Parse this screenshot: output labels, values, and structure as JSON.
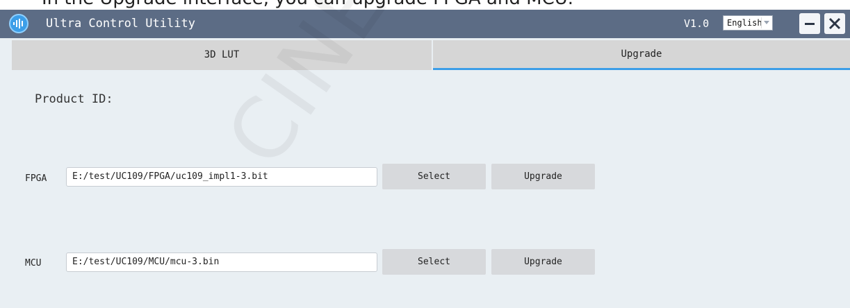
{
  "doc_caption": "In the Upgrade interface, you can upgrade FPGA and MCU.",
  "app": {
    "title": "Ultra Control Utility",
    "version": "V1.0",
    "language": "English",
    "colors": {
      "titlebar": "#5c6c85",
      "accent": "#3c9ee8"
    }
  },
  "tabs": [
    {
      "label": "3D LUT",
      "active": false
    },
    {
      "label": "Upgrade",
      "active": true
    }
  ],
  "upgrade": {
    "product_id_label": "Product ID:",
    "rows": [
      {
        "label": "FPGA",
        "path": "E:/test/UC109/FPGA/uc109_impl1-3.bit",
        "select": "Select",
        "upgrade": "Upgrade"
      },
      {
        "label": "MCU",
        "path": "E:/test/UC109/MCU/mcu-3.bin",
        "select": "Select",
        "upgrade": "Upgrade"
      }
    ]
  },
  "watermark": "CINETREND",
  "icons": [
    "app-logo-icon",
    "chevron-down-icon",
    "minimize-icon",
    "close-icon"
  ]
}
